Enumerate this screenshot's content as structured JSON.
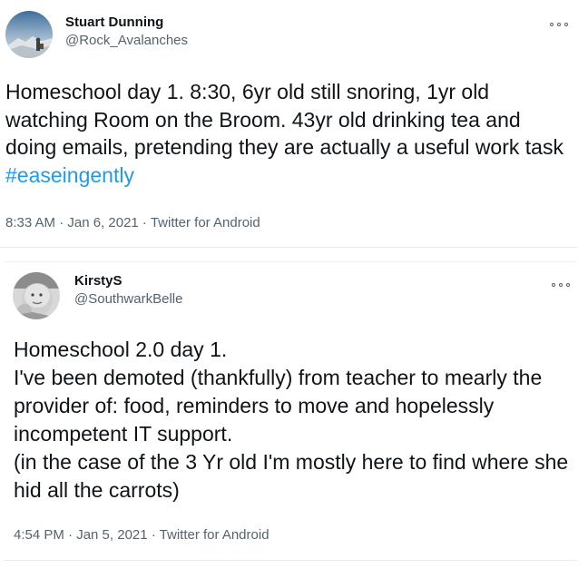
{
  "tweets": [
    {
      "display_name": "Stuart Dunning",
      "handle": "@Rock_Avalanches",
      "text": "Homeschool day 1. 8:30, 6yr old still snoring, 1yr old watching Room on the Broom. 43yr old drinking tea and doing emails, pretending they are actually a useful work task ",
      "hashtag": "#easeingently",
      "meta": "8:33 AM · Jan 6, 2021 · Twitter for Android",
      "avatar_icon": "mountain-photo-avatar"
    },
    {
      "display_name": "KirstyS",
      "handle": "@SouthwarkBelle",
      "text": "Homeschool 2.0 day 1.\nI've been demoted (thankfully) from teacher to mearly the provider of: food, reminders to move and hopelessly incompetent IT support.\n(in the case of the 3 Yr old I'm mostly here to find where she hid all the carrots)",
      "meta": "4:54 PM · Jan 5, 2021 · Twitter for Android",
      "avatar_icon": "baby-photo-avatar"
    }
  ],
  "colors": {
    "text": "#0f1419",
    "secondary": "#536471",
    "link": "#1d9bf0",
    "divider": "#e7e9ea"
  },
  "icons": {
    "more": "more-options-icon"
  }
}
